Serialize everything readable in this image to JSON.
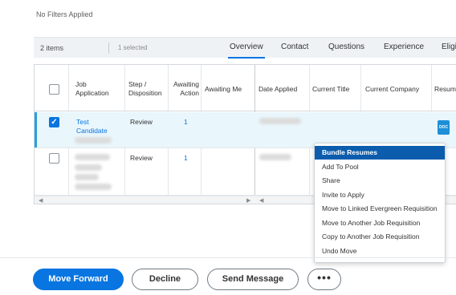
{
  "filters": {
    "text": "No Filters Applied"
  },
  "toolbar": {
    "count": "2 items",
    "selected": "1 selected",
    "tabs": [
      "Overview",
      "Contact",
      "Questions",
      "Experience",
      "Eligi"
    ],
    "active_tab": "Overview"
  },
  "table": {
    "columns": [
      "Job Application",
      "Step / Disposition",
      "Awaiting Action",
      "Awaiting Me",
      "Date Applied",
      "Current Title",
      "Current Company",
      "Resum"
    ],
    "column_lines": {
      "job_application": [
        "Job",
        "Application"
      ],
      "step": [
        "Step /",
        "Disposition"
      ],
      "awaiting_action": [
        "Awaiting",
        "Action"
      ]
    },
    "rows": [
      {
        "checked": true,
        "name_line1": "Test",
        "name_line2": "Candidate",
        "step": "Review",
        "awaiting_action": "1",
        "resume_icon": "doc-icon",
        "resume_label": "DOC"
      },
      {
        "checked": false,
        "step": "Review",
        "awaiting_action": "1"
      }
    ]
  },
  "menu": {
    "items": [
      "Bundle Resumes",
      "Add To Pool",
      "Share",
      "Invite to Apply",
      "Move to Linked Evergreen Requisition",
      "Move to Another Job Requisition",
      "Copy to Another Job Requisition",
      "Undo Move"
    ],
    "highlighted_index": 0
  },
  "actions": {
    "move_forward": "Move Forward",
    "decline": "Decline",
    "send_message": "Send Message",
    "more": "•••"
  },
  "colors": {
    "primary": "#0875e1",
    "menu_highlight": "#0b5cad",
    "selected_row": "#e9f6fc"
  }
}
